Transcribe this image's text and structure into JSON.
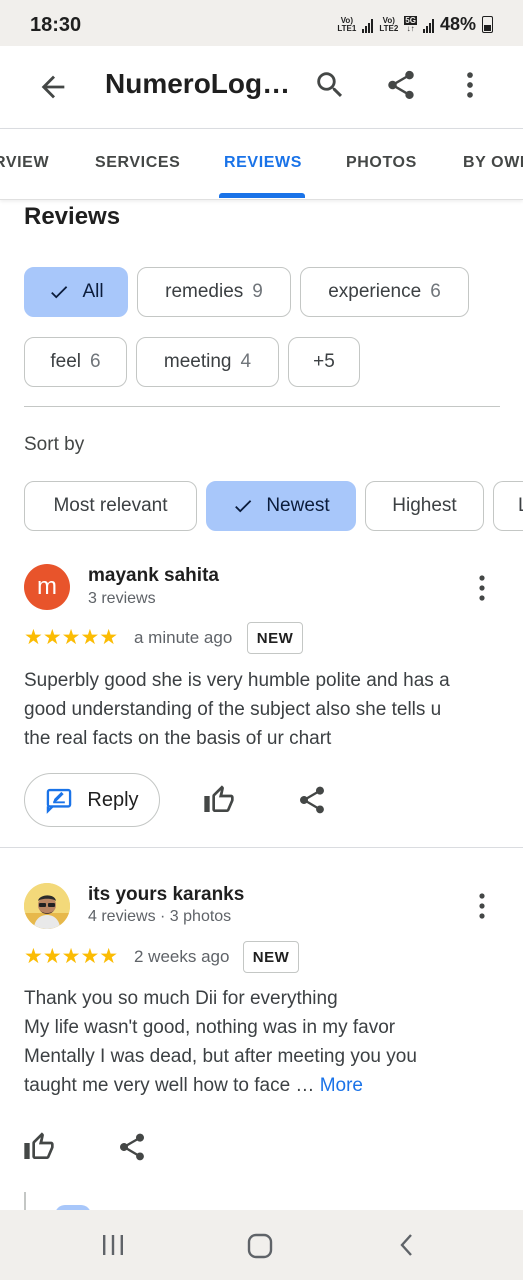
{
  "status_bar": {
    "time": "18:30",
    "sim1": "LTE1",
    "sim2": "LTE2",
    "net_badge": "5G",
    "battery": "48%"
  },
  "app_bar": {
    "title": "NumeroLog…",
    "icons": [
      "back-arrow-icon",
      "search-icon",
      "share-icon",
      "more-vert-icon"
    ]
  },
  "tabs": [
    {
      "label": "RVIEW",
      "active": false
    },
    {
      "label": "SERVICES",
      "active": false
    },
    {
      "label": "REVIEWS",
      "active": true
    },
    {
      "label": "PHOTOS",
      "active": false
    },
    {
      "label": "BY OWN",
      "active": false
    }
  ],
  "reviews_section": {
    "heading": "Reviews",
    "topics": [
      {
        "label": "All",
        "count": "",
        "selected": true
      },
      {
        "label": "remedies",
        "count": "9",
        "selected": false
      },
      {
        "label": "experience",
        "count": "6",
        "selected": false
      },
      {
        "label": "feel",
        "count": "6",
        "selected": false
      },
      {
        "label": "meeting",
        "count": "4",
        "selected": false
      },
      {
        "label": "+5",
        "count": "",
        "selected": false
      }
    ],
    "sort_label": "Sort by",
    "sort_options": [
      {
        "label": "Most relevant",
        "selected": false
      },
      {
        "label": "Newest",
        "selected": true
      },
      {
        "label": "Highest",
        "selected": false
      },
      {
        "label": "L",
        "selected": false
      }
    ]
  },
  "reviews": [
    {
      "avatar_letter": "m",
      "avatar_color": "#e8542b",
      "name": "mayank sahita",
      "meta": "3 reviews",
      "rating": 5,
      "stars": "★★★★★",
      "time": "a minute ago",
      "badge": "NEW",
      "text_lines": [
        "Superbly good she is very humble polite and has a",
        "good understanding of the subject also she tells u",
        "the real facts on the basis of ur chart"
      ],
      "reply_label": "Reply"
    },
    {
      "name": "its yours karanks",
      "meta": "4 reviews · 3 photos",
      "rating": 5,
      "stars": "★★★★★",
      "time": "2 weeks ago",
      "badge": "NEW",
      "text_lines": [
        "Thank you so much Dii for everything",
        "My life wasn't good, nothing was in my favor",
        "Mentally I was dead, but after meeting you you",
        "taught me very well how to face …"
      ],
      "more_label": "More"
    }
  ],
  "colors": {
    "accent": "#1a73e8",
    "chip_selected": "#a8c7fa",
    "star": "#fbbc04"
  }
}
